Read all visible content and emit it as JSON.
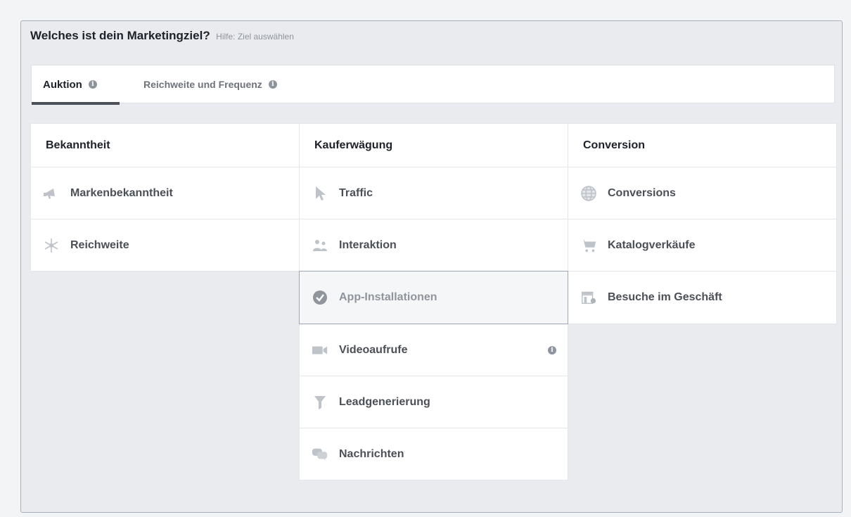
{
  "header": {
    "question": "Welches ist dein Marketingziel?",
    "help": "Hilfe: Ziel auswählen"
  },
  "tabs": [
    {
      "label": "Auktion",
      "active": true
    },
    {
      "label": "Reichweite und Frequenz",
      "active": false
    }
  ],
  "columns": [
    {
      "heading": "Bekanntheit",
      "items": [
        {
          "label": "Markenbekanntheit",
          "icon": "megaphone-icon"
        },
        {
          "label": "Reichweite",
          "icon": "reach-icon"
        }
      ]
    },
    {
      "heading": "Kauferwägung",
      "items": [
        {
          "label": "Traffic",
          "icon": "cursor-icon"
        },
        {
          "label": "Interaktion",
          "icon": "people-icon"
        },
        {
          "label": "App-Installationen",
          "icon": "check-circle-icon",
          "selected": true
        },
        {
          "label": "Videoaufrufe",
          "icon": "video-camera-icon",
          "info": true
        },
        {
          "label": "Leadgenerierung",
          "icon": "funnel-icon"
        },
        {
          "label": "Nachrichten",
          "icon": "chat-bubbles-icon"
        }
      ]
    },
    {
      "heading": "Conversion",
      "items": [
        {
          "label": "Conversions",
          "icon": "globe-icon"
        },
        {
          "label": "Katalogverkäufe",
          "icon": "shopping-cart-icon"
        },
        {
          "label": "Besuche im Geschäft",
          "icon": "store-icon"
        }
      ]
    }
  ],
  "info_glyph": "i",
  "colors": {
    "icon": "#bec3c9",
    "text": "#4b4f56",
    "selected_border": "#9ca6bb",
    "tab_underline": "#4b4f56"
  }
}
